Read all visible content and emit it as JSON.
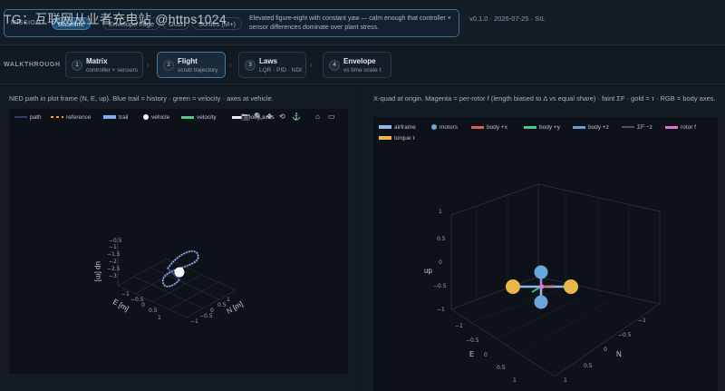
{
  "mission": {
    "label": "MISSION",
    "presets": [
      {
        "label": "Baseline",
        "active": true
      },
      {
        "label": "Envelope edge",
        "active": false
      },
      {
        "label": "Gust",
        "active": false
      },
      {
        "label": "Sorties (M+)",
        "active": false
      }
    ],
    "description": "Elevated figure-eight with constant yaw — calm enough that controller × sensor differences dominate over plant stress.",
    "watermark": "TG：互联网从业者充电站 @https1024"
  },
  "version": "v0.1.0 · 2026-07-25 · SIL",
  "walkthrough": {
    "label": "WALKTHROUGH",
    "steps": [
      {
        "num": "1",
        "title": "Matrix",
        "subtitle": "controller × sensors"
      },
      {
        "num": "2",
        "title": "Flight",
        "subtitle": "scrub trajectory"
      },
      {
        "num": "3",
        "title": "Laws",
        "subtitle": "LQR · PID · NDI"
      },
      {
        "num": "4",
        "title": "Envelope",
        "subtitle": "vs time scale τ"
      }
    ],
    "arrow": "›"
  },
  "flight_panel": {
    "description": "NED path in plot frame (N, E, up). Blue trail = history · green = velocity · axes at vehicle.",
    "legend": [
      {
        "label": "path",
        "color": "#2f3d6b",
        "style": "line"
      },
      {
        "label": "reference",
        "color": "#f0a030",
        "style": "dash"
      },
      {
        "label": "trail",
        "color": "#7fb0e8",
        "style": "line"
      },
      {
        "label": "vehicle",
        "color": "#f0f4f8",
        "style": "dot"
      },
      {
        "label": "velocity",
        "color": "#4ec98a",
        "style": "line"
      },
      {
        "label": "body axes",
        "color": "#e8ecf0",
        "style": "line"
      }
    ],
    "toolbar_icons": [
      "camera-icon",
      "zoom-icon",
      "pan-icon",
      "orbit-icon",
      "turntable-icon",
      "home-icon",
      "reset-camera-icon"
    ],
    "toolbar_glyphs": [
      "📷",
      "🔍",
      "✥",
      "⟲",
      "⚓",
      "⌂",
      "▭"
    ],
    "axes": {
      "n_label": "N [m]",
      "e_label": "E [m]",
      "up_label": "up [m]",
      "up_ticks": [
        "−0.5",
        "−1",
        "−1.5",
        "−2",
        "−2.5",
        "−3"
      ],
      "e_ticks": [
        "−1",
        "−0.5",
        "0",
        "0.5",
        "1"
      ],
      "n_ticks": [
        "−1",
        "−0.5",
        "0",
        "0.5",
        "1"
      ]
    }
  },
  "envelope_panel": {
    "description": "X-quad at origin. Magenta = per-rotor f (length biased to Δ vs equal share) · faint ΣF · gold = τ · RGB = body axes.",
    "legend": [
      {
        "label": "airframe",
        "color": "#8fb8ee",
        "style": "line"
      },
      {
        "label": "motors",
        "color": "#6aa6de",
        "style": "dot"
      },
      {
        "label": "body +x",
        "color": "#e05a5a",
        "style": "line"
      },
      {
        "label": "body +y",
        "color": "#4ec98a",
        "style": "line"
      },
      {
        "label": "body +z",
        "color": "#6a9ae0",
        "style": "line"
      },
      {
        "label": "ΣF −z",
        "color": "#4a5260",
        "style": "line"
      },
      {
        "label": "rotor f",
        "color": "#e070e0",
        "style": "line"
      },
      {
        "label": "torque τ",
        "color": "#e8b84a",
        "style": "line"
      }
    ],
    "axes": {
      "up_label": "up",
      "n_label": "N",
      "e_label": "E",
      "up_ticks": [
        "1",
        "0.5",
        "0",
        "−0.5",
        "−1"
      ],
      "e_ticks": [
        "−1",
        "−0.5",
        "0",
        "0.5",
        "1"
      ],
      "n_ticks": [
        "1",
        "0.5",
        "0",
        "−0.5",
        "−1"
      ]
    }
  }
}
